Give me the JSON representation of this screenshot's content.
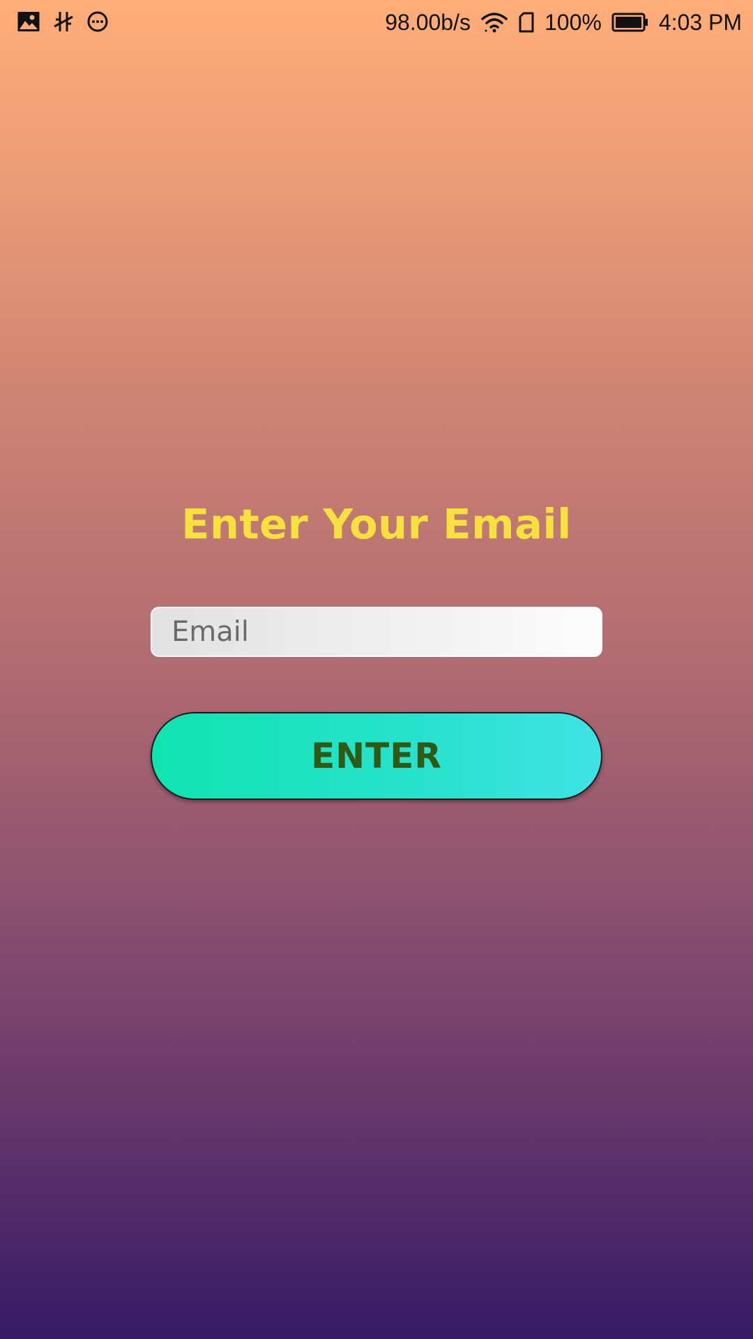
{
  "status_bar": {
    "left_icons": [
      "image-icon",
      "usb-debug-icon",
      "chat-bubble-icon"
    ],
    "network_speed": "98.00b/s",
    "battery_percent": "100%",
    "time": "4:03 PM",
    "right_icons": [
      "wifi-icon",
      "sim-card-icon",
      "battery-icon"
    ]
  },
  "main": {
    "title": "Enter Your Email",
    "email_placeholder": "Email",
    "email_value": "",
    "enter_button_label": "ENTER"
  },
  "colors": {
    "title": "#f7e13e",
    "button_text": "#2f5a16",
    "button_gradient_start": "#10e3b0",
    "button_gradient_end": "#3fe2e4",
    "background_top": "#ffad78",
    "background_bottom": "#361a66"
  }
}
